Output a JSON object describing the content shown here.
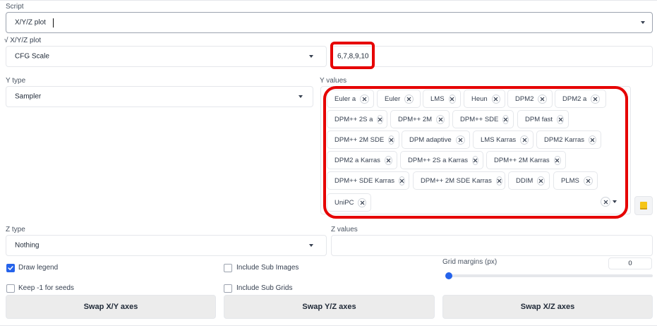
{
  "script": {
    "label": "Script",
    "value": "X/Y/Z plot"
  },
  "section_title": "√ X/Y/Z plot",
  "x_type": {
    "value": "CFG Scale"
  },
  "x_values": {
    "value": "6,7,8,9,10"
  },
  "y_type": {
    "label": "Y type",
    "value": "Sampler"
  },
  "y_values": {
    "label": "Y values",
    "chips": [
      "Euler a",
      "Euler",
      "LMS",
      "Heun",
      "DPM2",
      "DPM2 a",
      "DPM++ 2S a",
      "DPM++ 2M",
      "DPM++ SDE",
      "DPM fast",
      "DPM++ 2M SDE",
      "DPM adaptive",
      "LMS Karras",
      "DPM2 Karras",
      "DPM2 a Karras",
      "DPM++ 2S a Karras",
      "DPM++ 2M Karras",
      "DPM++ SDE Karras",
      "DPM++ 2M SDE Karras",
      "DDIM",
      "PLMS",
      "UniPC"
    ]
  },
  "z_type": {
    "label": "Z type",
    "value": "Nothing"
  },
  "z_values": {
    "label": "Z values",
    "value": ""
  },
  "checkboxes": {
    "draw_legend": {
      "label": "Draw legend",
      "checked": true
    },
    "include_sub_images": {
      "label": "Include Sub Images",
      "checked": false
    },
    "keep_seeds": {
      "label": "Keep -1 for seeds",
      "checked": false
    },
    "include_sub_grids": {
      "label": "Include Sub Grids",
      "checked": false
    }
  },
  "grid_margins": {
    "label": "Grid margins (px)",
    "value": "0",
    "slider_fraction": 0
  },
  "buttons": {
    "swap_xy": "Swap X/Y axes",
    "swap_yz": "Swap Y/Z axes",
    "swap_xz": "Swap X/Z axes"
  },
  "colors": {
    "accent": "#2563eb",
    "highlight": "#e60000",
    "button_bg": "#ececec",
    "tool_icon": "#f5c518"
  },
  "icons": {
    "chip_remove": "close-icon",
    "tool": "note-icon",
    "dropdown": "chevron-down-icon"
  }
}
